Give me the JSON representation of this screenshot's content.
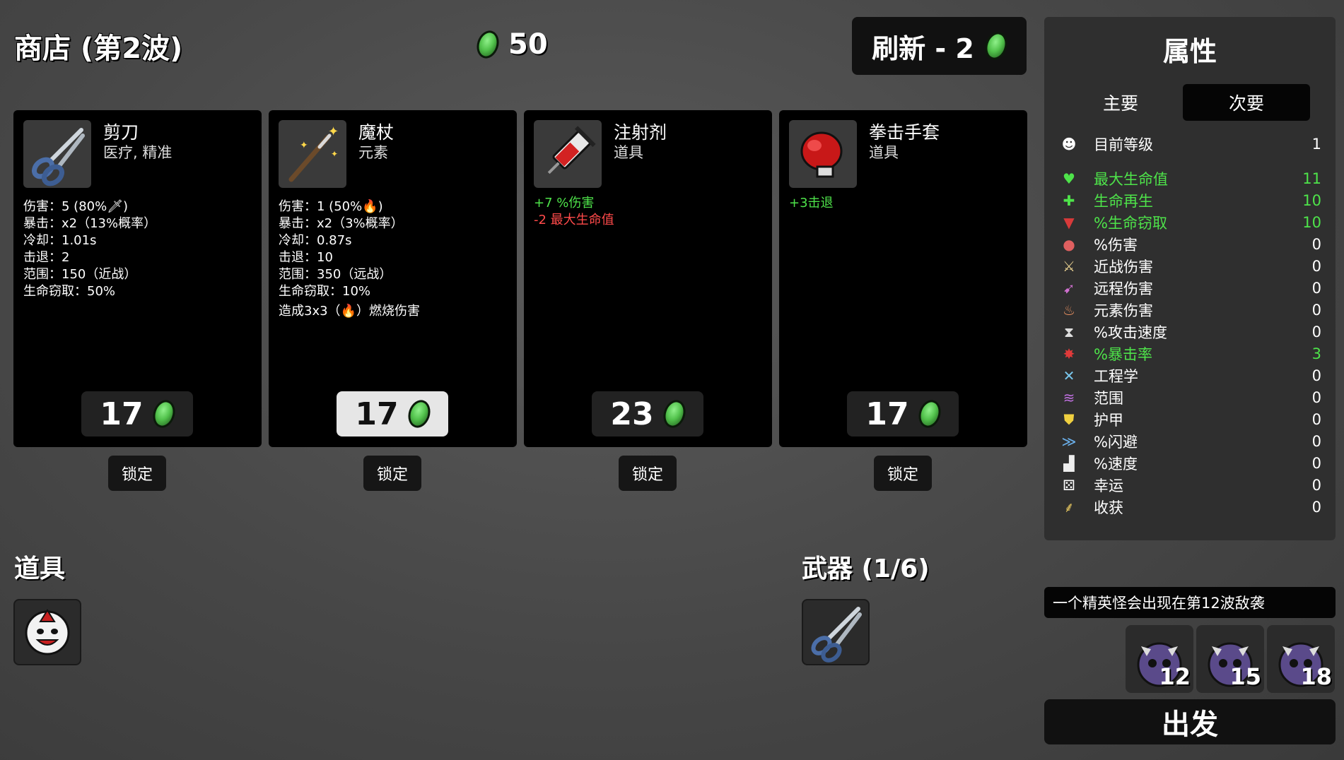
{
  "header": {
    "title": "商店 (第2波)",
    "money": "50",
    "reroll_label": "刷新 - 2"
  },
  "cards": [
    {
      "name": "剪刀",
      "type": "医疗, 精准",
      "icon": "scissors-icon",
      "stats": [
        "伤害：5 (80%🗡)",
        "暴击：x2（13%概率）",
        "冷却：1.01s",
        "击退：2",
        "范围：150（近战）",
        "生命窃取：50%"
      ],
      "price": "17",
      "lock": "锁定"
    },
    {
      "name": "魔杖",
      "type": "元素",
      "icon": "wand-icon",
      "stats": [
        "伤害：1 (50%🔥)",
        "暴击：x2（3%概率）",
        "冷却：0.87s",
        "击退：10",
        "范围：350（远战）",
        "生命窃取：10%",
        "造成3x3（🔥）燃烧伤害"
      ],
      "price": "17",
      "lock": "锁定"
    },
    {
      "name": "注射剂",
      "type": "道具",
      "icon": "syringe-icon",
      "stats": [
        "+7 %伤害",
        "-2 最大生命值"
      ],
      "price": "23",
      "lock": "锁定"
    },
    {
      "name": "拳击手套",
      "type": "道具",
      "icon": "boxing-glove-icon",
      "stats": [
        "+3击退"
      ],
      "price": "17",
      "lock": "锁定"
    }
  ],
  "sections": {
    "items_label": "道具",
    "weapons_label": "武器 (1/6)"
  },
  "stats_panel": {
    "title": "属性",
    "tabs": [
      "主要",
      "次要"
    ],
    "active_tab": "次要",
    "level": {
      "label": "目前等级",
      "value": "1"
    },
    "rows": [
      {
        "label": "最大生命值",
        "value": "11",
        "color": "#4ee34a",
        "icon": "heart-icon"
      },
      {
        "label": "生命再生",
        "value": "10",
        "color": "#4ee34a",
        "icon": "regen-icon"
      },
      {
        "label": "%生命窃取",
        "value": "10",
        "color": "#4ee34a",
        "icon": "fangs-icon"
      },
      {
        "label": "%伤害",
        "value": "0",
        "color": "#ffffff",
        "icon": "muscle-icon"
      },
      {
        "label": "近战伤害",
        "value": "0",
        "color": "#ffffff",
        "icon": "sword-icon"
      },
      {
        "label": "远程伤害",
        "value": "0",
        "color": "#ffffff",
        "icon": "bow-icon"
      },
      {
        "label": "元素伤害",
        "value": "0",
        "color": "#ffffff",
        "icon": "flame-icon"
      },
      {
        "label": "%攻击速度",
        "value": "0",
        "color": "#ffffff",
        "icon": "hourglass-icon"
      },
      {
        "label": "%暴击率",
        "value": "3",
        "color": "#4ee34a",
        "icon": "crit-icon"
      },
      {
        "label": "工程学",
        "value": "0",
        "color": "#ffffff",
        "icon": "wrench-icon"
      },
      {
        "label": "范围",
        "value": "0",
        "color": "#ffffff",
        "icon": "range-icon"
      },
      {
        "label": "护甲",
        "value": "0",
        "color": "#ffffff",
        "icon": "shield-icon"
      },
      {
        "label": "%闪避",
        "value": "0",
        "color": "#ffffff",
        "icon": "dodge-icon"
      },
      {
        "label": "%速度",
        "value": "0",
        "color": "#ffffff",
        "icon": "boot-icon"
      },
      {
        "label": "幸运",
        "value": "0",
        "color": "#ffffff",
        "icon": "dice-icon"
      },
      {
        "label": "收获",
        "value": "0",
        "color": "#ffffff",
        "icon": "wheat-icon"
      }
    ]
  },
  "elite_notice": "一个精英怪会出现在第12波敌袭",
  "waves": [
    "12",
    "15",
    "18"
  ],
  "go_label": "出发"
}
